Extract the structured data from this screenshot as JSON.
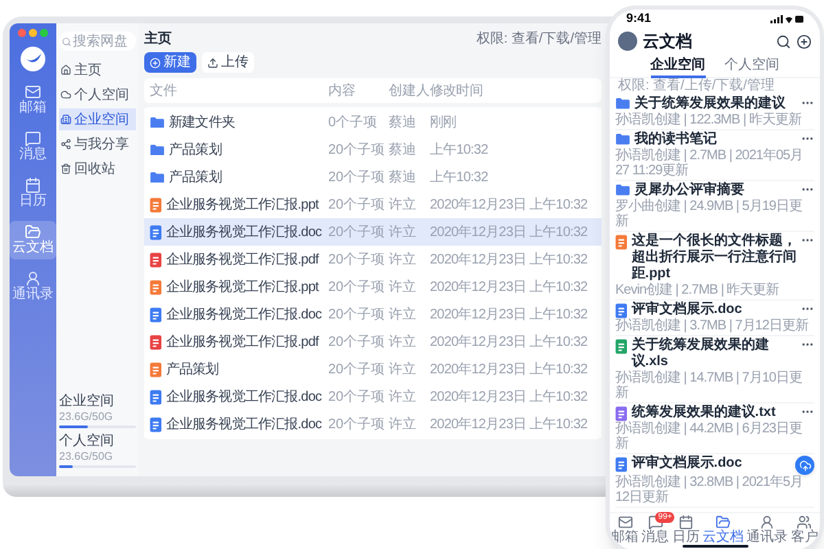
{
  "laptop": {
    "window_controls": [
      {
        "color": "#ff5f57"
      },
      {
        "color": "#febc2e"
      },
      {
        "color": "#28c840"
      }
    ],
    "nav_rail": [
      {
        "label": "邮箱",
        "kind": "mail",
        "selected": false
      },
      {
        "label": "消息",
        "kind": "message",
        "selected": false
      },
      {
        "label": "日历",
        "kind": "calendar",
        "selected": false
      },
      {
        "label": "云文档",
        "kind": "docs",
        "selected": true
      },
      {
        "label": "通讯录",
        "kind": "contacts",
        "selected": false
      }
    ],
    "search": {
      "placeholder": "搜索网盘"
    },
    "sidebar": {
      "items": [
        {
          "label": "主页",
          "kind": "home",
          "selected": false
        },
        {
          "label": "个人空间",
          "kind": "cloud",
          "selected": false
        },
        {
          "label": "企业空间",
          "kind": "building",
          "selected": true
        },
        {
          "label": "与我分享",
          "kind": "share",
          "selected": false
        },
        {
          "label": "回收站",
          "kind": "trash",
          "selected": false
        }
      ]
    },
    "storage": [
      {
        "label": "企业空间",
        "reading": "23.6G/50G",
        "level": 0.38
      },
      {
        "label": "个人空间",
        "reading": "23.6G/50G",
        "level": 0.18
      }
    ],
    "breadcrumb": "主页",
    "permission_note": "权限: 查看/下载/管理",
    "buttons": [
      {
        "label": "新建",
        "kind": "primary"
      },
      {
        "label": "上传",
        "kind": "secondary"
      }
    ],
    "table": {
      "columns": [
        "文件",
        "内容",
        "创建人",
        "修改时间"
      ],
      "rows": [
        {
          "kind": "folder",
          "name": "新建文件夹",
          "content": "0个子项",
          "creator": "蔡迪",
          "modified": "刚刚",
          "selected": false
        },
        {
          "kind": "folder",
          "name": "产品策划",
          "content": "20个子项",
          "creator": "蔡迪",
          "modified": "上午10:32",
          "selected": false
        },
        {
          "kind": "folder",
          "name": "产品策划",
          "content": "20个子项",
          "creator": "蔡迪",
          "modified": "上午10:32",
          "selected": false
        },
        {
          "kind": "ppt",
          "name": "企业服务视觉工作汇报.ppt",
          "content": "20个子项",
          "creator": "许立",
          "modified": "2020年12月23日 上午10:32",
          "selected": false
        },
        {
          "kind": "doc",
          "name": "企业服务视觉工作汇报.doc",
          "content": "20个子项",
          "creator": "许立",
          "modified": "2020年12月23日 上午10:32",
          "selected": true
        },
        {
          "kind": "pdf",
          "name": "企业服务视觉工作汇报.pdf",
          "content": "20个子项",
          "creator": "许立",
          "modified": "2020年12月23日 上午10:32",
          "selected": false
        },
        {
          "kind": "ppt",
          "name": "企业服务视觉工作汇报.ppt",
          "content": "20个子项",
          "creator": "许立",
          "modified": "2020年12月23日 上午10:32",
          "selected": false
        },
        {
          "kind": "doc",
          "name": "企业服务视觉工作汇报.doc",
          "content": "20个子项",
          "creator": "许立",
          "modified": "2020年12月23日 上午10:32",
          "selected": false
        },
        {
          "kind": "pdf",
          "name": "企业服务视觉工作汇报.pdf",
          "content": "20个子项",
          "creator": "许立",
          "modified": "2020年12月23日 上午10:32",
          "selected": false
        },
        {
          "kind": "ppt",
          "name": "产品策划",
          "content": "20个子项",
          "creator": "许立",
          "modified": "2020年12月23日 上午10:32",
          "selected": false
        },
        {
          "kind": "doc",
          "name": "企业服务视觉工作汇报.doc",
          "content": "20个子项",
          "creator": "许立",
          "modified": "2020年12月23日 上午10:32",
          "selected": false
        },
        {
          "kind": "doc",
          "name": "企业服务视觉工作汇报.doc",
          "content": "20个子项",
          "creator": "许立",
          "modified": "2020年12月23日 上午10:32",
          "selected": false
        }
      ]
    }
  },
  "phone": {
    "status_time": "9:41",
    "title": "云文档",
    "tabs": [
      {
        "label": "企业空间",
        "selected": true
      },
      {
        "label": "个人空间",
        "selected": false
      }
    ],
    "permission_note": "权限: 查看/上传/下载/管理",
    "files": [
      {
        "kind": "folder",
        "name": "关于统筹发展效果的建议",
        "meta": "孙语凯创建 | 122.3MB | 昨天更新",
        "menu": true
      },
      {
        "kind": "folder",
        "name": "我的读书笔记",
        "meta": "孙语凯创建 | 2.7MB | 2021年05月27 11:29更新",
        "menu": true
      },
      {
        "kind": "folder",
        "name": "灵犀办公评审摘要",
        "meta": "罗小曲创建 | 24.9MB | 5月19日更新",
        "menu": true
      },
      {
        "kind": "ppt",
        "name": "这是一个很长的文件标题，超出折行展示一行注意行间距.ppt",
        "meta": "Kevin创建 | 2.7MB | 昨天更新",
        "menu": true
      },
      {
        "kind": "doc",
        "name": "评审文档展示.doc",
        "meta": "孙语凯创建 | 3.7MB | 7月12日更新",
        "menu": true
      },
      {
        "kind": "xls",
        "name": "关于统筹发展效果的建议.xls",
        "meta": "孙语凯创建 | 14.7MB | 7月10日更新",
        "menu": true
      },
      {
        "kind": "txt",
        "name": "统筹发展效果的建议.txt",
        "meta": "孙语凯创建 | 44.2MB | 6月23日更新",
        "menu": true
      },
      {
        "kind": "doc",
        "name": "评审文档展示.doc",
        "meta": "孙语凯创建 | 32.8MB | 2021年5月12日更新",
        "menu": false
      }
    ],
    "tab_bar": [
      {
        "label": "邮箱",
        "kind": "mail",
        "selected": false
      },
      {
        "label": "消息",
        "kind": "message",
        "selected": false,
        "badge": "99+"
      },
      {
        "label": "日历",
        "kind": "calendar",
        "selected": false
      },
      {
        "label": "云文档",
        "kind": "docs",
        "selected": true
      },
      {
        "label": "通讯录",
        "kind": "contacts",
        "selected": false
      },
      {
        "label": "客户",
        "kind": "customer",
        "selected": false
      }
    ]
  }
}
